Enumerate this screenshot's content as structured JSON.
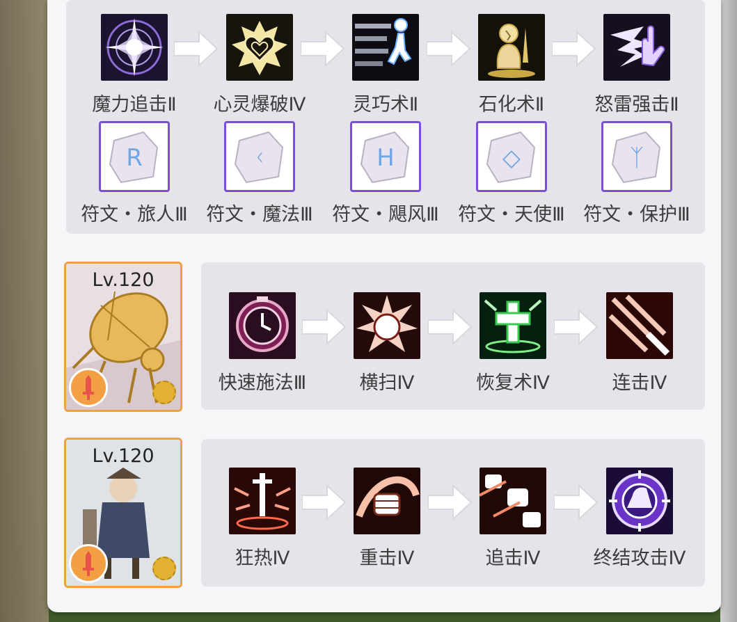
{
  "row1": [
    {
      "label": "魔力追击Ⅱ",
      "icon": "magic-burst-icon"
    },
    {
      "label": "心灵爆破Ⅳ",
      "icon": "heart-blast-icon"
    },
    {
      "label": "灵巧术Ⅱ",
      "icon": "agility-runner-icon"
    },
    {
      "label": "石化术Ⅱ",
      "icon": "petrify-statue-icon"
    },
    {
      "label": "怒雷强击Ⅱ",
      "icon": "thunder-hand-icon"
    }
  ],
  "runes": [
    {
      "label": "符文・旅人Ⅲ",
      "glyph": "R"
    },
    {
      "label": "符文・魔法Ⅲ",
      "glyph": "ᚲ"
    },
    {
      "label": "符文・飓风Ⅲ",
      "glyph": "H"
    },
    {
      "label": "符文・天使Ⅲ",
      "glyph": "◇"
    },
    {
      "label": "符文・保护Ⅲ",
      "glyph": "ᛉ"
    }
  ],
  "card1": {
    "level": "Lv.120",
    "skills": [
      {
        "label": "快速施法Ⅲ",
        "icon": "clock-icon"
      },
      {
        "label": "横扫Ⅳ",
        "icon": "sweep-burst-icon"
      },
      {
        "label": "恢复术Ⅳ",
        "icon": "heal-cross-icon"
      },
      {
        "label": "连击Ⅳ",
        "icon": "combo-slash-icon"
      }
    ]
  },
  "card2": {
    "level": "Lv.120",
    "skills": [
      {
        "label": "狂热Ⅳ",
        "icon": "frenzy-sword-icon"
      },
      {
        "label": "重击Ⅳ",
        "icon": "heavy-fist-icon"
      },
      {
        "label": "追击Ⅳ",
        "icon": "pursuit-fists-icon"
      },
      {
        "label": "终结攻击Ⅳ",
        "icon": "finish-hat-icon"
      }
    ]
  }
}
